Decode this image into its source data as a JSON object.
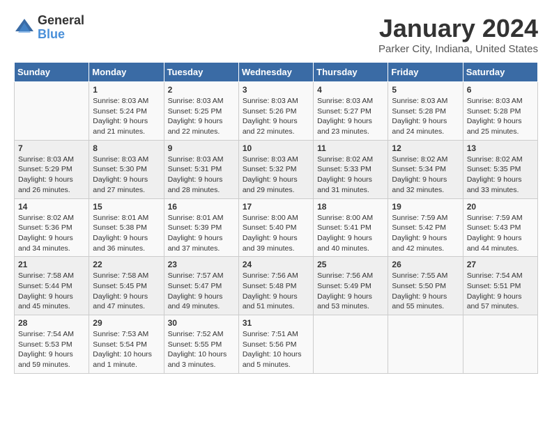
{
  "logo": {
    "general": "General",
    "blue": "Blue"
  },
  "title": "January 2024",
  "location": "Parker City, Indiana, United States",
  "days_header": [
    "Sunday",
    "Monday",
    "Tuesday",
    "Wednesday",
    "Thursday",
    "Friday",
    "Saturday"
  ],
  "weeks": [
    [
      {
        "num": "",
        "info": ""
      },
      {
        "num": "1",
        "info": "Sunrise: 8:03 AM\nSunset: 5:24 PM\nDaylight: 9 hours\nand 21 minutes."
      },
      {
        "num": "2",
        "info": "Sunrise: 8:03 AM\nSunset: 5:25 PM\nDaylight: 9 hours\nand 22 minutes."
      },
      {
        "num": "3",
        "info": "Sunrise: 8:03 AM\nSunset: 5:26 PM\nDaylight: 9 hours\nand 22 minutes."
      },
      {
        "num": "4",
        "info": "Sunrise: 8:03 AM\nSunset: 5:27 PM\nDaylight: 9 hours\nand 23 minutes."
      },
      {
        "num": "5",
        "info": "Sunrise: 8:03 AM\nSunset: 5:28 PM\nDaylight: 9 hours\nand 24 minutes."
      },
      {
        "num": "6",
        "info": "Sunrise: 8:03 AM\nSunset: 5:28 PM\nDaylight: 9 hours\nand 25 minutes."
      }
    ],
    [
      {
        "num": "7",
        "info": "Sunrise: 8:03 AM\nSunset: 5:29 PM\nDaylight: 9 hours\nand 26 minutes."
      },
      {
        "num": "8",
        "info": "Sunrise: 8:03 AM\nSunset: 5:30 PM\nDaylight: 9 hours\nand 27 minutes."
      },
      {
        "num": "9",
        "info": "Sunrise: 8:03 AM\nSunset: 5:31 PM\nDaylight: 9 hours\nand 28 minutes."
      },
      {
        "num": "10",
        "info": "Sunrise: 8:03 AM\nSunset: 5:32 PM\nDaylight: 9 hours\nand 29 minutes."
      },
      {
        "num": "11",
        "info": "Sunrise: 8:02 AM\nSunset: 5:33 PM\nDaylight: 9 hours\nand 31 minutes."
      },
      {
        "num": "12",
        "info": "Sunrise: 8:02 AM\nSunset: 5:34 PM\nDaylight: 9 hours\nand 32 minutes."
      },
      {
        "num": "13",
        "info": "Sunrise: 8:02 AM\nSunset: 5:35 PM\nDaylight: 9 hours\nand 33 minutes."
      }
    ],
    [
      {
        "num": "14",
        "info": "Sunrise: 8:02 AM\nSunset: 5:36 PM\nDaylight: 9 hours\nand 34 minutes."
      },
      {
        "num": "15",
        "info": "Sunrise: 8:01 AM\nSunset: 5:38 PM\nDaylight: 9 hours\nand 36 minutes."
      },
      {
        "num": "16",
        "info": "Sunrise: 8:01 AM\nSunset: 5:39 PM\nDaylight: 9 hours\nand 37 minutes."
      },
      {
        "num": "17",
        "info": "Sunrise: 8:00 AM\nSunset: 5:40 PM\nDaylight: 9 hours\nand 39 minutes."
      },
      {
        "num": "18",
        "info": "Sunrise: 8:00 AM\nSunset: 5:41 PM\nDaylight: 9 hours\nand 40 minutes."
      },
      {
        "num": "19",
        "info": "Sunrise: 7:59 AM\nSunset: 5:42 PM\nDaylight: 9 hours\nand 42 minutes."
      },
      {
        "num": "20",
        "info": "Sunrise: 7:59 AM\nSunset: 5:43 PM\nDaylight: 9 hours\nand 44 minutes."
      }
    ],
    [
      {
        "num": "21",
        "info": "Sunrise: 7:58 AM\nSunset: 5:44 PM\nDaylight: 9 hours\nand 45 minutes."
      },
      {
        "num": "22",
        "info": "Sunrise: 7:58 AM\nSunset: 5:45 PM\nDaylight: 9 hours\nand 47 minutes."
      },
      {
        "num": "23",
        "info": "Sunrise: 7:57 AM\nSunset: 5:47 PM\nDaylight: 9 hours\nand 49 minutes."
      },
      {
        "num": "24",
        "info": "Sunrise: 7:56 AM\nSunset: 5:48 PM\nDaylight: 9 hours\nand 51 minutes."
      },
      {
        "num": "25",
        "info": "Sunrise: 7:56 AM\nSunset: 5:49 PM\nDaylight: 9 hours\nand 53 minutes."
      },
      {
        "num": "26",
        "info": "Sunrise: 7:55 AM\nSunset: 5:50 PM\nDaylight: 9 hours\nand 55 minutes."
      },
      {
        "num": "27",
        "info": "Sunrise: 7:54 AM\nSunset: 5:51 PM\nDaylight: 9 hours\nand 57 minutes."
      }
    ],
    [
      {
        "num": "28",
        "info": "Sunrise: 7:54 AM\nSunset: 5:53 PM\nDaylight: 9 hours\nand 59 minutes."
      },
      {
        "num": "29",
        "info": "Sunrise: 7:53 AM\nSunset: 5:54 PM\nDaylight: 10 hours\nand 1 minute."
      },
      {
        "num": "30",
        "info": "Sunrise: 7:52 AM\nSunset: 5:55 PM\nDaylight: 10 hours\nand 3 minutes."
      },
      {
        "num": "31",
        "info": "Sunrise: 7:51 AM\nSunset: 5:56 PM\nDaylight: 10 hours\nand 5 minutes."
      },
      {
        "num": "",
        "info": ""
      },
      {
        "num": "",
        "info": ""
      },
      {
        "num": "",
        "info": ""
      }
    ]
  ]
}
